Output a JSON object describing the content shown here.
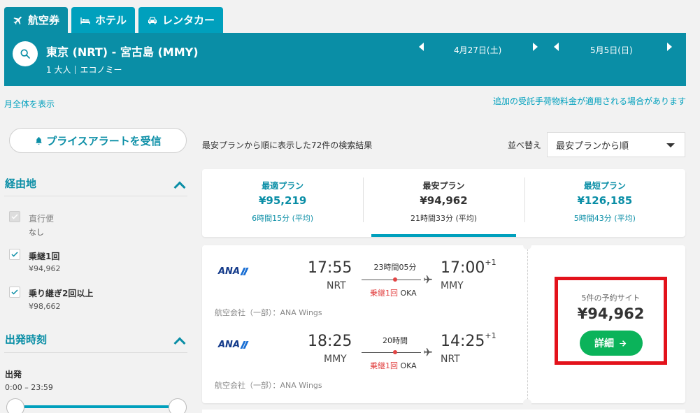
{
  "tabs": [
    {
      "label": "航空券",
      "icon": "plane-icon"
    },
    {
      "label": "ホテル",
      "icon": "bed-icon"
    },
    {
      "label": "レンタカー",
      "icon": "car-icon"
    }
  ],
  "search": {
    "route": "東京 (NRT) - 宮古島 (MMY)",
    "passengers": "1 大人",
    "cabin": "エコノミー",
    "depart_date": "4月27日(土)",
    "return_date": "5月5日(日)"
  },
  "links": {
    "month_view": "月全体を表示",
    "baggage_note": "追加の受託手荷物料金が適用される場合があります"
  },
  "price_alert": {
    "label": "プライスアラートを受信"
  },
  "filters": {
    "stops": {
      "title": "経由地",
      "options": [
        {
          "label": "直行便",
          "sub": "なし",
          "checked": true,
          "disabled": true
        },
        {
          "label": "乗継1回",
          "sub": "¥94,962",
          "checked": true,
          "disabled": false
        },
        {
          "label": "乗り継ぎ2回以上",
          "sub": "¥98,662",
          "checked": true,
          "disabled": false
        }
      ]
    },
    "departure": {
      "title": "出発時刻",
      "label": "出発",
      "range": "0:00 – 23:59"
    }
  },
  "results": {
    "count_text": "最安プランから順に表示した72件の検索結果",
    "sort_label": "並べ替え",
    "sort_value": "最安プランから順"
  },
  "plans": [
    {
      "title": "最適プラン",
      "price": "¥95,219",
      "time": "6時間15分 (平均)",
      "active": false
    },
    {
      "title": "最安プラン",
      "price": "¥94,962",
      "time": "21時間33分 (平均)",
      "active": true
    },
    {
      "title": "最短プラン",
      "price": "¥126,185",
      "time": "5時間43分 (平均)",
      "active": false
    }
  ],
  "card": {
    "outbound": {
      "airline": "ANA",
      "dep_time": "17:55",
      "dep_code": "NRT",
      "duration": "23時間05分",
      "stop_label": "乗継1回",
      "stop_code": "OKA",
      "arr_time": "17:00",
      "arr_day": "+1",
      "arr_code": "MMY",
      "operated": "航空会社（一部）：ANA Wings"
    },
    "inbound": {
      "airline": "ANA",
      "dep_time": "18:25",
      "dep_code": "MMY",
      "duration": "20時間",
      "stop_label": "乗継1回",
      "stop_code": "OKA",
      "arr_time": "14:25",
      "arr_day": "+1",
      "arr_code": "NRT",
      "operated": "航空会社（一部）：ANA Wings"
    },
    "booking": {
      "sites": "5件の予約サイト",
      "price": "¥94,962",
      "button": "詳細"
    }
  },
  "colors": {
    "brand": "#0a8ea6",
    "accent": "#00a0bd",
    "cta": "#0bb35a",
    "highlight": "#e3121b",
    "stop": "#e24545"
  }
}
